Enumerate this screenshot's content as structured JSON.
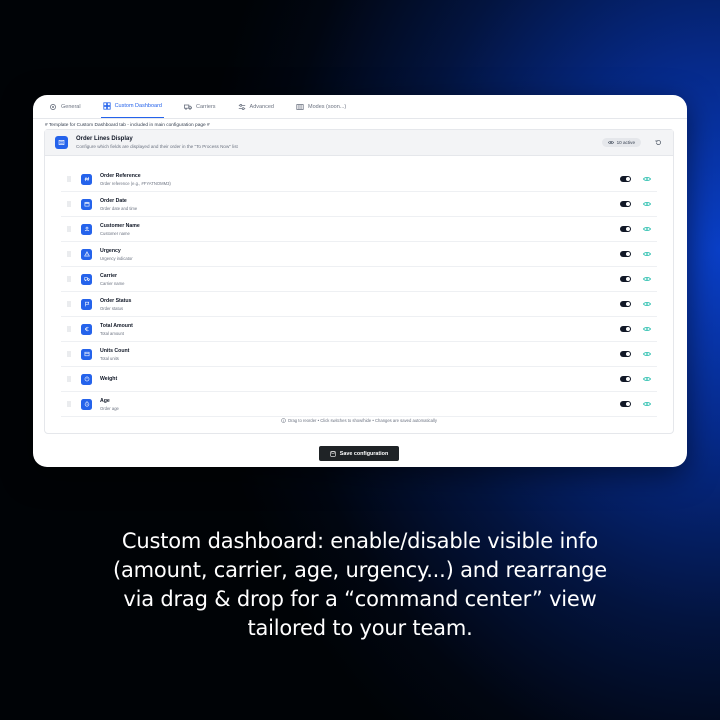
{
  "tabs": [
    {
      "label": "General",
      "icon": "gear-icon",
      "active": false
    },
    {
      "label": "Custom Dashboard",
      "icon": "dashboard-icon",
      "active": true
    },
    {
      "label": "Carriers",
      "icon": "truck-icon",
      "active": false
    },
    {
      "label": "Advanced",
      "icon": "sliders-icon",
      "active": false
    },
    {
      "label": "Modes (soon...)",
      "icon": "grid-icon",
      "active": false
    }
  ],
  "template_note": "# Template for Custom Dashboard tab - included in main configuration page #",
  "panel": {
    "title": "Order Lines Display",
    "subtitle": "Configure which fields are displayed and their order in the \"To Process Now\" list",
    "active_badge": "10 active"
  },
  "rows": [
    {
      "title": "Order Reference",
      "subtitle": "Order reference (e.g., #FYATNOMM3)",
      "icon": "hash-icon"
    },
    {
      "title": "Order Date",
      "subtitle": "Order date and time",
      "icon": "calendar-icon"
    },
    {
      "title": "Customer Name",
      "subtitle": "Customer name",
      "icon": "user-icon"
    },
    {
      "title": "Urgency",
      "subtitle": "Urgency indicator",
      "icon": "warning-icon"
    },
    {
      "title": "Carrier",
      "subtitle": "Carrier name",
      "icon": "truck-icon"
    },
    {
      "title": "Order Status",
      "subtitle": "Order status",
      "icon": "flag-icon"
    },
    {
      "title": "Total Amount",
      "subtitle": "Total amount",
      "icon": "euro-icon"
    },
    {
      "title": "Units Count",
      "subtitle": "Total units",
      "icon": "box-icon"
    },
    {
      "title": "Weight",
      "subtitle": "",
      "icon": "weight-icon"
    },
    {
      "title": "Age",
      "subtitle": "Order age",
      "icon": "clock-icon"
    }
  ],
  "footer_note": "Drag to reorder • Click switches to show/hide • Changes are saved automatically",
  "save_button": "Save configuration",
  "caption_lines": [
    "Custom dashboard: enable/disable visible info",
    "(amount, carrier, age, urgency...) and rearrange",
    "via drag & drop for a “command center” view",
    "tailored to your team."
  ],
  "colors": {
    "accent": "#2563eb",
    "toggle_on": "#111827",
    "eye": "#14b8a6"
  }
}
